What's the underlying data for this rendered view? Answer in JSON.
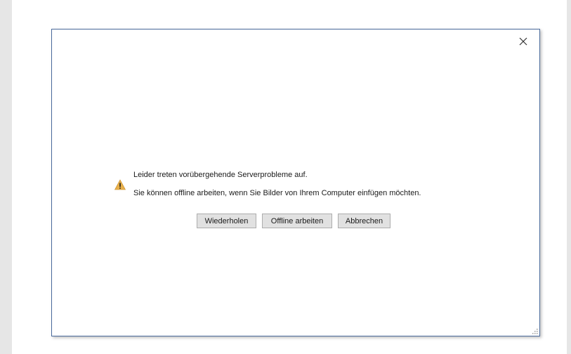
{
  "dialog": {
    "close_label": "×",
    "message_line1": "Leider treten vorübergehende Serverprobleme auf.",
    "message_line2": "Sie können offline arbeiten, wenn Sie Bilder von Ihrem Computer einfügen möchten.",
    "buttons": {
      "retry": "Wiederholen",
      "offline": "Offline arbeiten",
      "cancel": "Abbrechen"
    },
    "icons": {
      "warning": "warning-triangle-icon",
      "close": "close-icon",
      "resize": "resize-grip-icon"
    },
    "colors": {
      "border": "#4a6a9c",
      "warning_fill": "#e8b04a",
      "button_bg": "#e1e1e1"
    }
  }
}
